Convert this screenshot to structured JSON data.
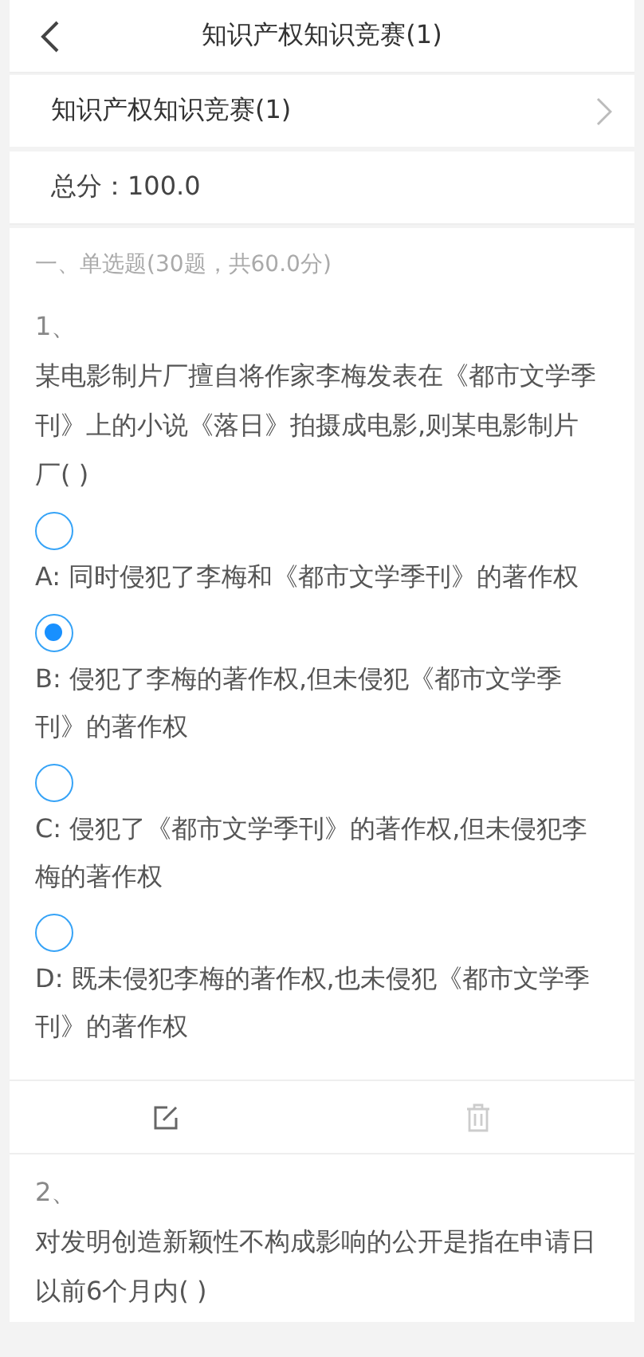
{
  "header": {
    "title": "知识产权知识竞赛(1)"
  },
  "contest": {
    "name": "知识产权知识竞赛(1)"
  },
  "total_score": "总分：100.0",
  "section": "一、单选题(30题，共60.0分)",
  "questions": [
    {
      "number": "1、",
      "text": "某电影制片厂擅自将作家李梅发表在《都市文学季刊》上的小说《落日》拍摄成电影,则某电影制片厂( )",
      "options": [
        {
          "text": "A: 同时侵犯了李梅和《都市文学季刊》的著作权",
          "selected": false
        },
        {
          "text": "B: 侵犯了李梅的著作权,但未侵犯《都市文学季刊》的著作权",
          "selected": true
        },
        {
          "text": "C: 侵犯了《都市文学季刊》的著作权,但未侵犯李梅的著作权",
          "selected": false
        },
        {
          "text": "D: 既未侵犯李梅的著作权,也未侵犯《都市文学季刊》的著作权",
          "selected": false
        }
      ]
    },
    {
      "number": "2、",
      "text": "对发明创造新颖性不构成影响的公开是指在申请日以前6个月内( )"
    }
  ]
}
